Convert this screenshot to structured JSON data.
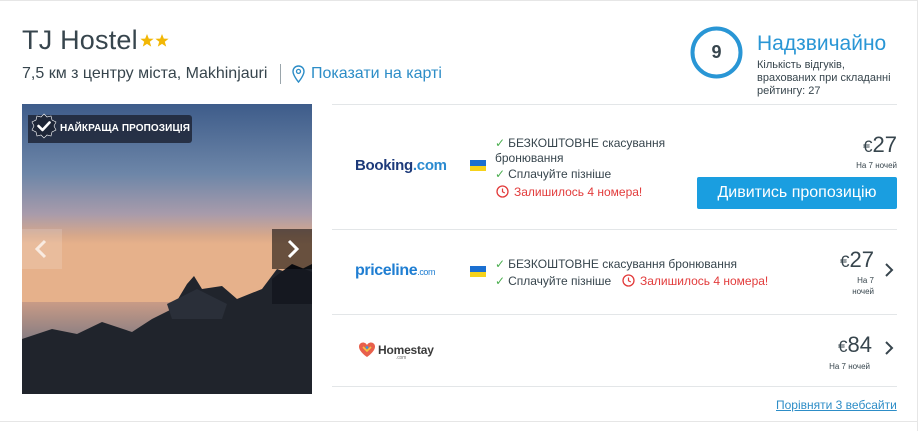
{
  "hotel": {
    "name": "TJ Hostel",
    "star_rating": 2,
    "location_text": "7,5 км з центру міста, Makhinjauri",
    "map_link": "Показати на карті"
  },
  "rating": {
    "score": "9",
    "label": "Надзвичайно",
    "note": "Кількість відгуків, врахованих при складанні рейтингу: 27"
  },
  "photo": {
    "badge": "НАЙКРАЩА ПРОПОЗИЦІЯ"
  },
  "offers": [
    {
      "partner": "Booking",
      "partner_suffix": ".com",
      "features": [
        "БЕЗКОШТОВНЕ скасування бронювання",
        "Сплачуйте пізніше"
      ],
      "rooms_left": "Залишилось 4 номера!",
      "currency": "€",
      "price": "27",
      "nights": "На 7 ночей",
      "cta": "Дивитись пропозицію"
    },
    {
      "partner": "priceline",
      "partner_suffix": ".com",
      "features": [
        "БЕЗКОШТОВНЕ скасування бронювання",
        "Сплачуйте пізніше"
      ],
      "rooms_left": "Залишилось 4 номера!",
      "currency": "€",
      "price": "27",
      "nights_line1": "На 7",
      "nights_line2": "ночей"
    },
    {
      "partner": "Homestay",
      "partner_suffix": ".com",
      "currency": "€",
      "price": "84",
      "nights": "На 7 ночей"
    }
  ],
  "compare_link": "Порівняти 3 вебсайти",
  "colors": {
    "accent": "#1a9ee0",
    "link": "#2d8dc7",
    "rating_ring": "#2996d5",
    "warning": "#e23b3b",
    "ok": "#4caf50"
  },
  "icons": [
    "star-icon",
    "map-pin-icon",
    "check-icon",
    "clock-icon",
    "chevron-left-icon",
    "chevron-right-icon",
    "ukraine-flag-icon"
  ]
}
